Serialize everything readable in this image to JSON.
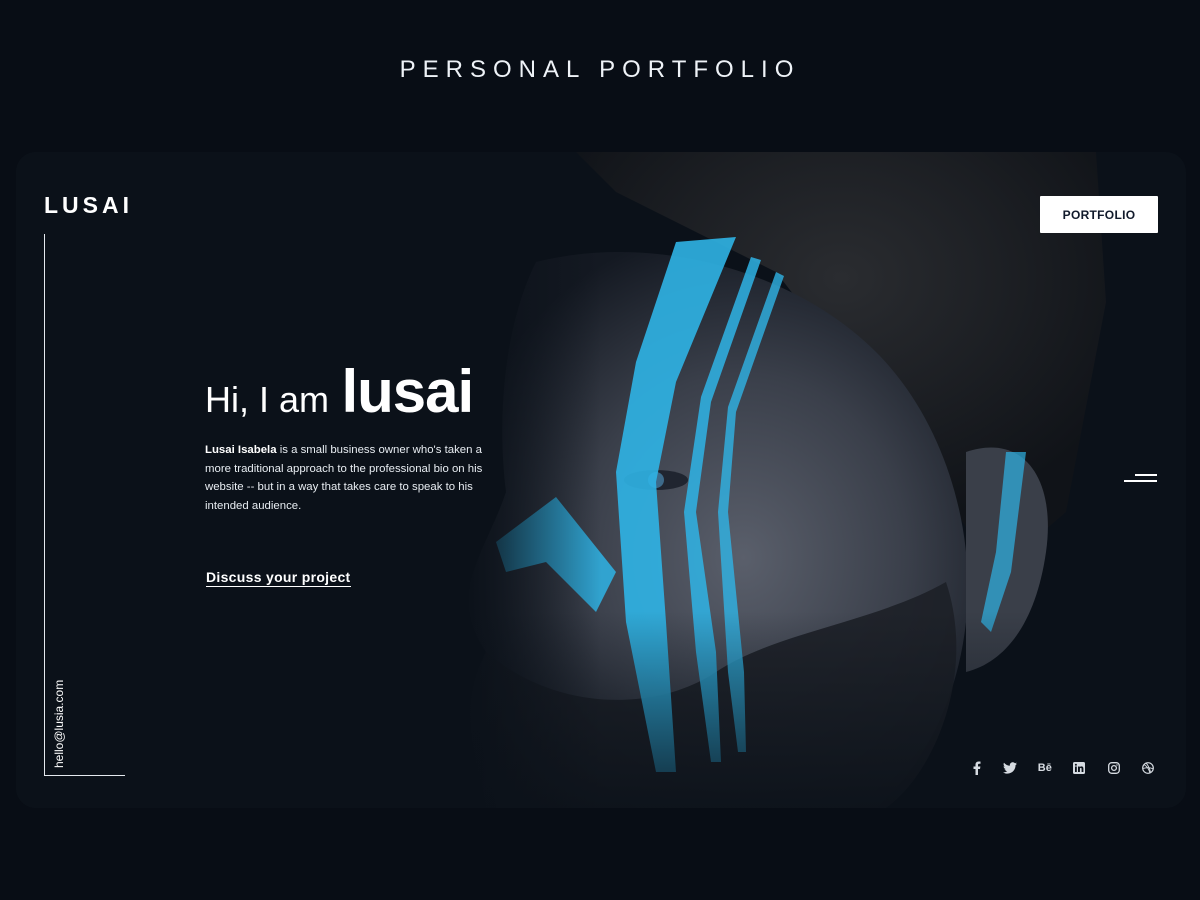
{
  "page_heading": "PERSONAL PORTFOLIO",
  "header": {
    "brand": "LUSAI",
    "portfolio_button": "PORTFOLIO"
  },
  "sidebar": {
    "email": "hello@lusia.com"
  },
  "hero": {
    "greeting_prefix": "Hi, I am",
    "greeting_name": "lusai",
    "bio_name": "Lusai Isabela",
    "bio_text": " is a small business owner who's taken a more traditional approach to the professional bio on his website -- but in a way that takes care to speak to his intended audience.",
    "cta_label": "Discuss your project"
  },
  "socials": [
    {
      "icon": "facebook-icon"
    },
    {
      "icon": "twitter-icon"
    },
    {
      "icon": "behance-icon",
      "label": "Bē"
    },
    {
      "icon": "linkedin-icon"
    },
    {
      "icon": "instagram-icon"
    },
    {
      "icon": "dribbble-icon"
    }
  ],
  "colors": {
    "page_background": "#080d15",
    "card_background": "#0b1119",
    "accent_paint": "#2fb4e6",
    "text": "#ffffff"
  }
}
